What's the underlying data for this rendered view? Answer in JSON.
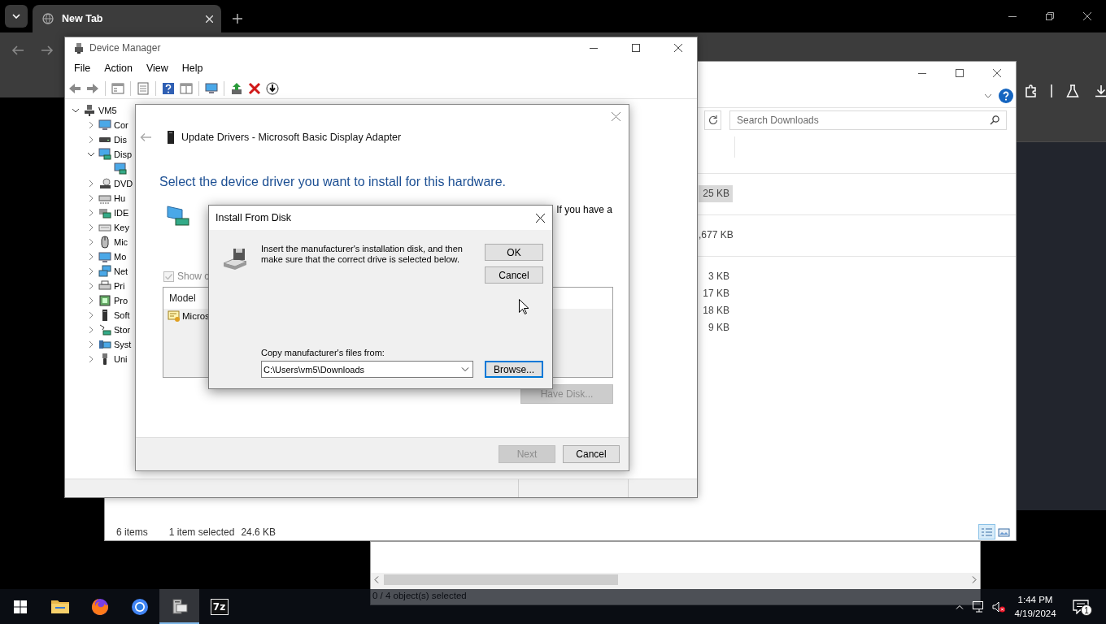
{
  "browser": {
    "tabs": [
      {
        "title": "New Tab",
        "selected": true
      }
    ]
  },
  "explorer": {
    "search": {
      "placeholder": "Search Downloads"
    },
    "sizes": [
      {
        "size": "25 KB",
        "selected": true,
        "group_start": true
      },
      {
        "size": ",677 KB",
        "selected": false,
        "group_start": true
      },
      {
        "size": "3 KB",
        "selected": false,
        "group_start": true
      },
      {
        "size": "17 KB",
        "selected": false,
        "group_start": false
      },
      {
        "size": "18 KB",
        "selected": false,
        "group_start": false
      },
      {
        "size": "9 KB",
        "selected": false,
        "group_start": false
      }
    ],
    "status": {
      "count": "6 items",
      "selection": "1 item selected",
      "size": "24.6 KB"
    },
    "views": [
      {
        "kind": "details",
        "selected": true
      },
      {
        "kind": "tiles",
        "selected": false
      }
    ]
  },
  "device_manager": {
    "title": "Device Manager",
    "menu": [
      "File",
      "Action",
      "View",
      "Help"
    ],
    "tree": {
      "label": "VM5",
      "expanded": true,
      "children": [
        {
          "label": "Cor",
          "expanded": false
        },
        {
          "label": "Dis",
          "expanded": false
        },
        {
          "label": "Disp",
          "expanded": true,
          "children": [
            {
              "kind": "device"
            }
          ]
        },
        {
          "label": "DVD",
          "expanded": false
        },
        {
          "label": "Hu",
          "expanded": false
        },
        {
          "label": "IDE",
          "expanded": false
        },
        {
          "label": "Key",
          "expanded": false
        },
        {
          "label": "Mic",
          "expanded": false
        },
        {
          "label": "Mo",
          "expanded": false
        },
        {
          "label": "Net",
          "expanded": false
        },
        {
          "label": "Pri",
          "expanded": false
        },
        {
          "label": "Pro",
          "expanded": false
        },
        {
          "label": "Soft",
          "expanded": false
        },
        {
          "label": "Stor",
          "expanded": false
        },
        {
          "label": "Syst",
          "expanded": false
        },
        {
          "label": "Uni",
          "expanded": false
        }
      ]
    }
  },
  "update_drivers": {
    "title": "Update Drivers - Microsoft Basic Display Adapter",
    "heading": "Select the device driver you want to install for this hardware.",
    "intro_tail": "If you have a",
    "show_compatible": {
      "label": "Show c",
      "checked": true,
      "disabled": true
    },
    "list": {
      "column": "Model",
      "items": [
        "Micros"
      ]
    },
    "have_disk": {
      "label": "Have Disk...",
      "disabled": true
    },
    "buttons": [
      {
        "label": "Next",
        "disabled": true
      },
      {
        "label": "Cancel",
        "disabled": false
      }
    ]
  },
  "install_from_disk": {
    "title": "Install From Disk",
    "message": "Insert the manufacturer's installation disk, and then make sure that the correct drive is selected below.",
    "buttons": [
      {
        "label": "OK"
      },
      {
        "label": "Cancel"
      }
    ],
    "copy_label": "Copy manufacturer's files from:",
    "path": "C:\\Users\\vm5\\Downloads",
    "browse": {
      "label": "Browse...",
      "focused": true
    }
  },
  "background_window": {
    "status": "0 / 4 object(s) selected"
  },
  "taskbar": {
    "apps": [
      {
        "kind": "explorer",
        "active": false
      },
      {
        "kind": "firefox",
        "active": false
      },
      {
        "kind": "chrome",
        "active": false
      },
      {
        "kind": "devmgr",
        "active": true
      },
      {
        "kind": "archiver",
        "label": "7z",
        "active": false
      }
    ],
    "volume": {
      "muted": true
    },
    "time": "1:44 PM",
    "date": "4/19/2024",
    "notifications": "1"
  }
}
